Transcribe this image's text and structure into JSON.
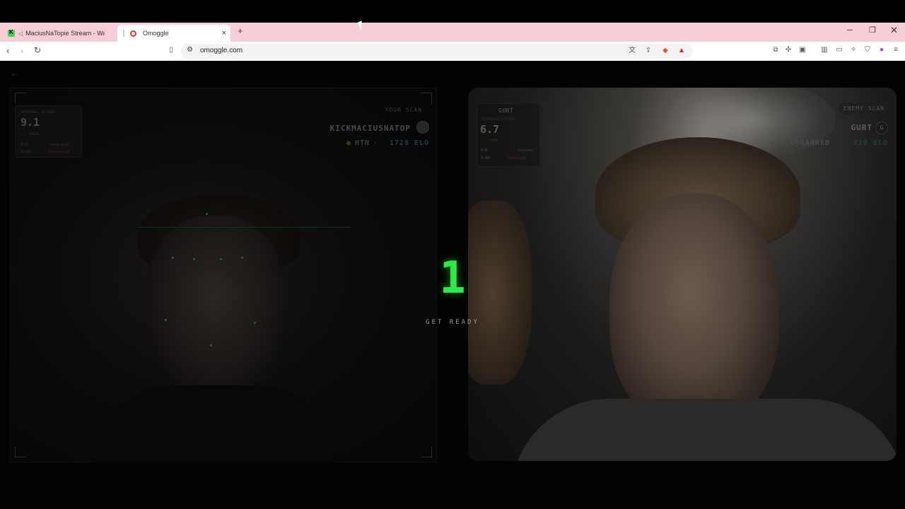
{
  "browser": {
    "tabs": [
      {
        "label": "MaciusNaTopie Stream - Watch L"
      },
      {
        "label": "Omoggle"
      }
    ],
    "new_tab_label": "+",
    "close_tab_label": "×",
    "url": "omoggle.com"
  },
  "page": {
    "countdown": "1",
    "status": "GET READY",
    "you": {
      "scan_label": "YOUR SCAN",
      "username": "KICKMACIUSNATOP",
      "rank": "HTN",
      "elo": "1728 ELO",
      "card": {
        "title": "OVERALL SCORE",
        "score": "9.1",
        "tag": "IDEAL",
        "rows": [
          {
            "key": "EYE",
            "value": "Hunter Eyes"
          },
          {
            "key": "FLAW",
            "value": "Asymmetrical"
          }
        ]
      }
    },
    "enemy": {
      "scan_label": "ENEMY SCAN",
      "username": "GURT",
      "avatar_initial": "G",
      "rank": "UNRANKED",
      "elo": "320 ELO",
      "card": {
        "name": "GURT",
        "title": "OVERALL SCORE",
        "score": "6.7",
        "tag": "HTN",
        "rows": [
          {
            "key": "EYE",
            "value": "Symmetry"
          },
          {
            "key": "FLAW",
            "value": "Weaker jaw"
          }
        ]
      }
    }
  },
  "colors": {
    "accent_green": "#2bea4a",
    "tab_strip": "#f7cdd7"
  }
}
